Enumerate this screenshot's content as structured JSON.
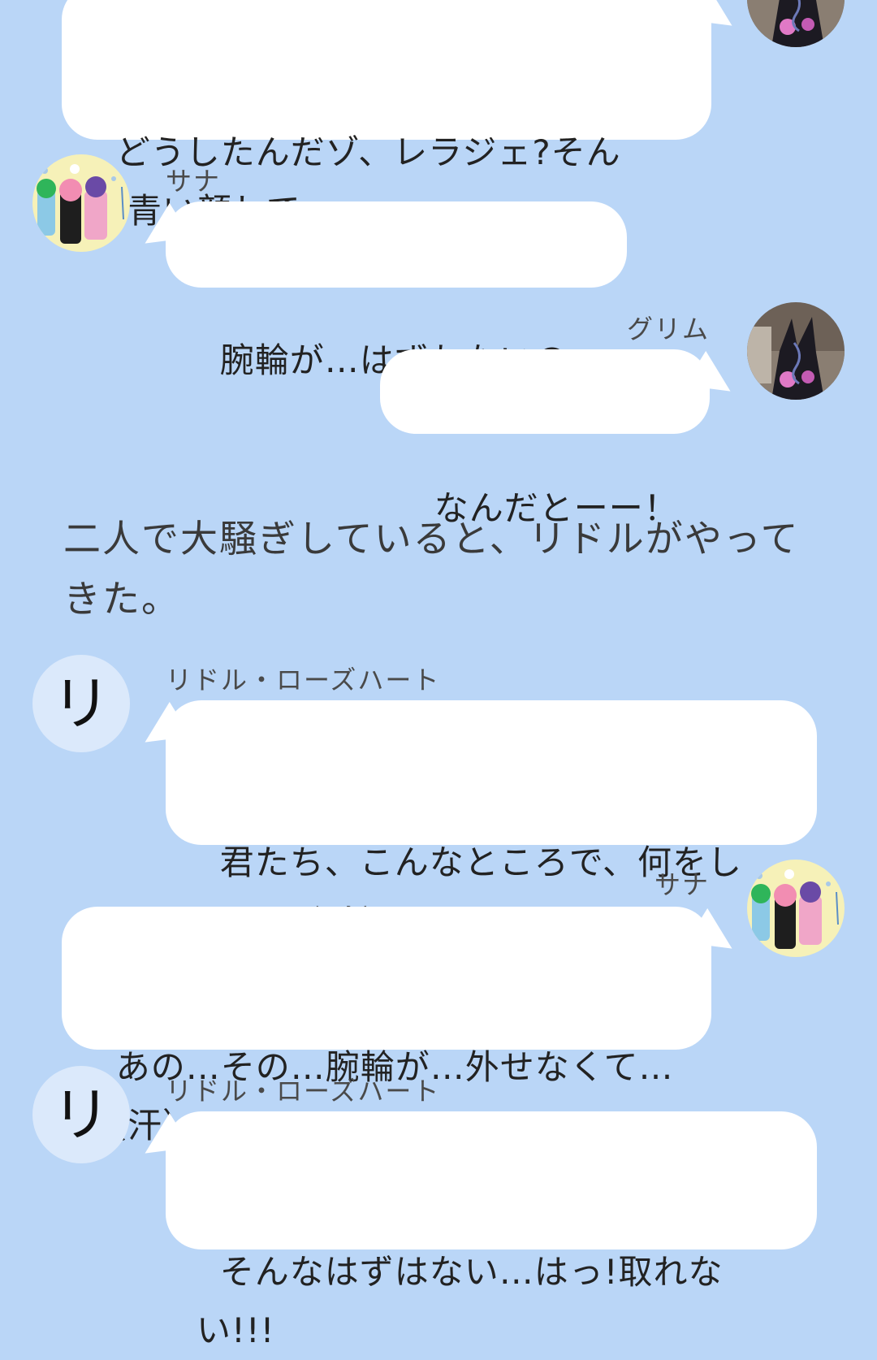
{
  "colors": {
    "background": "#bad6f7",
    "bubble": "#ffffff",
    "text": "#222222",
    "letter_avatar_bg": "#dbe9fb"
  },
  "messages": [
    {
      "id": "m1",
      "side": "right",
      "sender": "",
      "avatar": "grim-photo-icon",
      "text": "どうしたんだゾ、レラジェ?そん\nな青い顔して"
    },
    {
      "id": "m2",
      "side": "left",
      "sender": "サナ",
      "avatar": "sana-group-illustration-icon",
      "text": "腕輪が…はずれないの…"
    },
    {
      "id": "m3",
      "side": "right",
      "sender": "グリム",
      "avatar": "grim-photo-icon",
      "text": "なんだとーー！"
    },
    {
      "id": "m4",
      "side": "left",
      "sender": "リドル・ローズハート",
      "avatar_letter": "リ",
      "text": "君たち、こんなところで、何をし\nているんだい?"
    },
    {
      "id": "m5",
      "side": "right",
      "sender": "サナ",
      "avatar": "sana-group-illustration-icon",
      "text": "あの…その…腕輪が…外せなくて…\n（汗）"
    },
    {
      "id": "m6",
      "side": "left",
      "sender": "リドル・ローズハート",
      "avatar_letter": "リ",
      "text": "そんなはずはない…はっ!取れな\nい!!!"
    }
  ],
  "narration": "二人で大騒ぎしていると、リドルがやって\nきた。"
}
